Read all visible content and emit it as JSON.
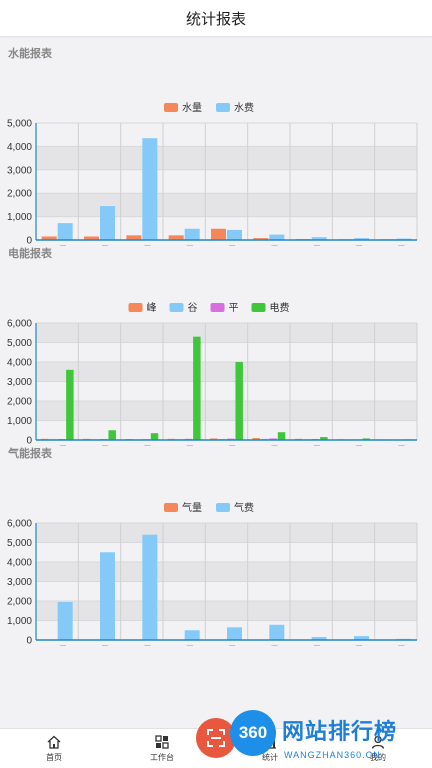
{
  "header": {
    "title": "统计报表"
  },
  "sections": [
    {
      "title": "水能报表",
      "chart_data": {
        "type": "bar",
        "categories": [
          "01月",
          "02月",
          "03月",
          "04月",
          "05月",
          "06月",
          "07月",
          "08月",
          "09月"
        ],
        "ylim": [
          0,
          5000
        ],
        "yticks": [
          "0",
          "1,000",
          "2,000",
          "3,000",
          "4,000",
          "5,000"
        ],
        "series": [
          {
            "name": "水量",
            "color": "#f5875b",
            "values": [
              150,
              150,
              200,
              200,
              480,
              80,
              40,
              30,
              30
            ]
          },
          {
            "name": "水费",
            "color": "#85c9f8",
            "values": [
              720,
              1450,
              4350,
              480,
              430,
              230,
              120,
              80,
              60
            ]
          }
        ]
      }
    },
    {
      "title": "电能报表",
      "chart_data": {
        "type": "bar",
        "categories": [
          "01月",
          "02月",
          "03月",
          "04月",
          "05月",
          "06月",
          "07月",
          "08月",
          "09月"
        ],
        "ylim": [
          0,
          6000
        ],
        "yticks": [
          "0",
          "1,000",
          "2,000",
          "3,000",
          "4,000",
          "5,000",
          "6,000"
        ],
        "series": [
          {
            "name": "峰",
            "color": "#f5875b",
            "values": [
              60,
              60,
              50,
              60,
              80,
              100,
              60,
              40,
              30
            ]
          },
          {
            "name": "谷",
            "color": "#85c9f8",
            "values": [
              40,
              40,
              30,
              40,
              50,
              60,
              40,
              30,
              20
            ]
          },
          {
            "name": "平",
            "color": "#d66fe0",
            "values": [
              50,
              50,
              40,
              60,
              70,
              80,
              50,
              30,
              20
            ]
          },
          {
            "name": "电费",
            "color": "#3fc63b",
            "values": [
              3600,
              500,
              350,
              5300,
              4000,
              400,
              150,
              80,
              30
            ]
          }
        ]
      }
    },
    {
      "title": "气能报表",
      "chart_data": {
        "type": "bar",
        "categories": [
          "01月",
          "02月",
          "03月",
          "04月",
          "05月",
          "06月",
          "07月",
          "08月",
          "09月"
        ],
        "ylim": [
          0,
          6000
        ],
        "yticks": [
          "0",
          "1,000",
          "2,000",
          "3,000",
          "4,000",
          "5,000",
          "6,000"
        ],
        "series": [
          {
            "name": "气量",
            "color": "#f5875b",
            "values": [
              0,
              0,
              0,
              0,
              0,
              0,
              0,
              0,
              0
            ]
          },
          {
            "name": "气费",
            "color": "#85c9f8",
            "values": [
              1950,
              4500,
              5400,
              500,
              650,
              780,
              150,
              200,
              60
            ]
          }
        ]
      }
    }
  ],
  "tabs": [
    {
      "label": "首页",
      "icon": "home-icon"
    },
    {
      "label": "工作台",
      "icon": "grid-icon"
    },
    {
      "label": "统计",
      "icon": "chart-icon"
    },
    {
      "label": "我的",
      "icon": "user-icon"
    }
  ],
  "watermark": {
    "badge": "360",
    "text": "网站排行榜",
    "sub": "WANGZHAN360.CN"
  }
}
